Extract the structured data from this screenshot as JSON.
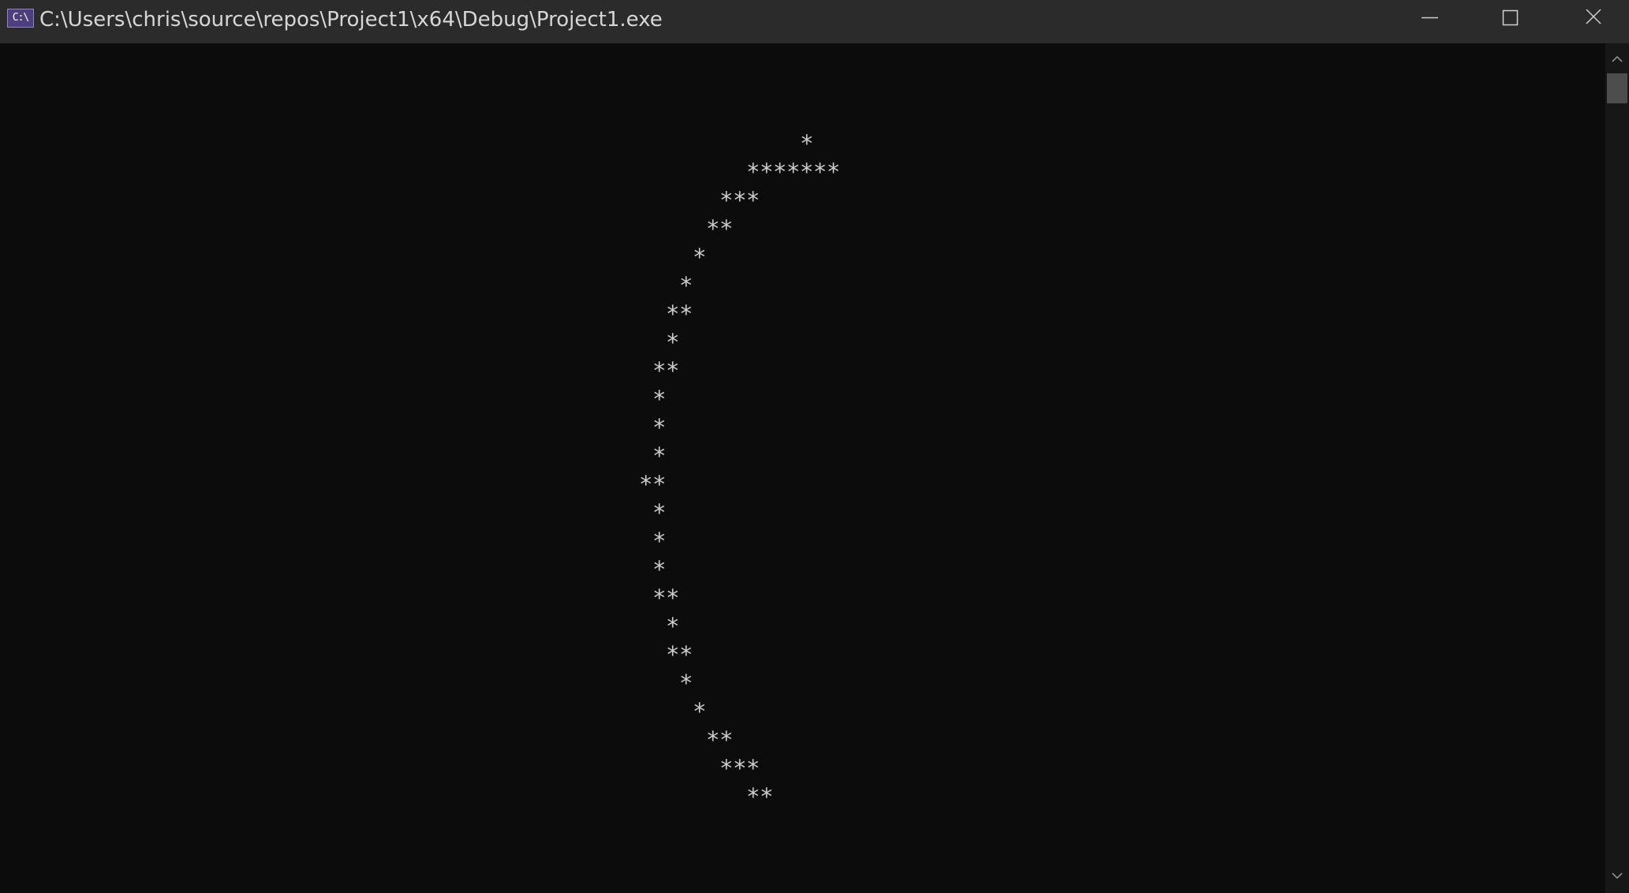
{
  "window": {
    "title": "C:\\Users\\chris\\source\\repos\\Project1\\x64\\Debug\\Project1.exe",
    "icon_text": "C:\\",
    "icon": "console-app-icon",
    "accent_color": "#4d3f7f"
  },
  "caption_buttons": {
    "minimize": "minimize-icon",
    "maximize": "maximize-icon",
    "close": "close-icon"
  },
  "console": {
    "background": "#0c0c0c",
    "foreground": "#cccccc",
    "lines": [
      "*",
      "*******",
      "***",
      "**",
      "*",
      "*",
      "**",
      "*",
      "**",
      "*",
      "*",
      "*",
      "**",
      "*",
      "*",
      "*",
      "**",
      "*",
      "**",
      "*",
      "*",
      "**",
      "***",
      "**"
    ]
  },
  "scrollbar": {
    "up": "chevron-up-icon",
    "down": "chevron-down-icon"
  }
}
